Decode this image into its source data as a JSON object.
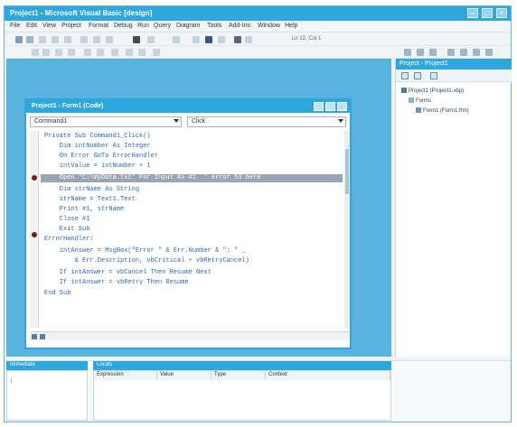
{
  "app": {
    "title": "Project1 - Microsoft Visual Basic [design]",
    "colors": {
      "accent": "#2ea7dc",
      "workspace": "#5ab3de",
      "keyword": "#2c68b4",
      "breakpoint": "#7a1f1f"
    }
  },
  "menu": [
    "File",
    "Edit",
    "View",
    "Project",
    "Format",
    "Debug",
    "Run",
    "Query",
    "Diagram",
    "Tools",
    "Add-Ins",
    "Window",
    "Help"
  ],
  "toolbar": {
    "position_readout": "Ln 12, Col 1"
  },
  "code_window": {
    "title": "Project1 - Form1 (Code)",
    "object_combo": "Command1",
    "proc_combo": "Click",
    "lines": [
      "Private Sub Command1_Click()",
      "    Dim intNumber As Integer",
      "    On Error GoTo ErrorHandler",
      "    intValue = intNumber + 1",
      "    Open \"C:\\myData.txt\" For Input As #1  ' error 53 here",
      "    Dim strName As String",
      "    strName = Text1.Text",
      "    Print #1, strName",
      "    Close #1",
      "    Exit Sub",
      "ErrorHandler:",
      "    intAnswer = MsgBox(\"Error \" & Err.Number & \": \" _",
      "        & Err.Description, vbCritical + vbRetryCancel)",
      "    If intAnswer = vbCancel Then Resume Next",
      "    If intAnswer = vbRetry Then Resume",
      "End Sub"
    ]
  },
  "project_explorer": {
    "title": "Project - Project1",
    "tree": [
      "Project1 (Project1.vbp)",
      "Forms",
      "Form1 (Form1.frm)"
    ]
  },
  "immediate": {
    "title": "Immediate"
  },
  "locals": {
    "title": "Locals",
    "columns": [
      "Expression",
      "Value",
      "Type",
      "Context"
    ]
  }
}
